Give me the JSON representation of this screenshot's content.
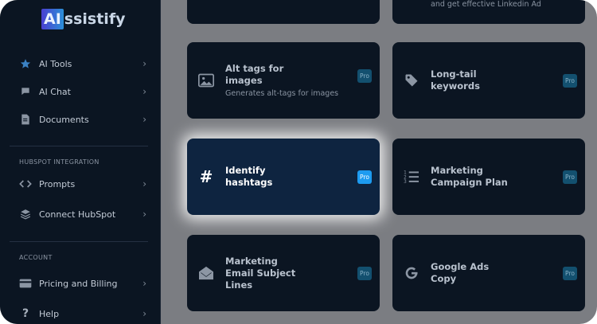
{
  "brand": {
    "logo_box": "AI",
    "logo_rest": "ssistify"
  },
  "sidebar": {
    "items": [
      {
        "label": "AI Tools",
        "icon": "star-icon"
      },
      {
        "label": "AI Chat",
        "icon": "chat-bubble-icon"
      },
      {
        "label": "Documents",
        "icon": "document-icon"
      }
    ],
    "hubspot_section": "HUBSPOT INTEGRATION",
    "hubspot_items": [
      {
        "label": "Prompts",
        "icon": "code-icon"
      },
      {
        "label": "Connect HubSpot",
        "icon": "layers-icon"
      }
    ],
    "account_section": "ACCOUNT",
    "account_items": [
      {
        "label": "Pricing and Billing",
        "icon": "credit-card-icon"
      },
      {
        "label": "Help",
        "icon": "question-icon"
      }
    ]
  },
  "tools": {
    "top_right_partial": "and get effective Linkedin Ad",
    "cards": [
      {
        "title": "Alt tags for images",
        "title_lines": [
          "Alt tags for",
          "images"
        ],
        "desc": "Generates alt-tags for images",
        "badge": "Pro",
        "icon": "image-icon"
      },
      {
        "title": "Long-tail keywords",
        "title_lines": [
          "Long-tail",
          "keywords"
        ],
        "desc": "",
        "badge": "Pro",
        "icon": "tag-icon"
      },
      {
        "title": "Identify hashtags",
        "title_lines": [
          "Identify",
          "hashtags"
        ],
        "desc": "",
        "badge": "Pro",
        "icon": "hashtag-icon"
      },
      {
        "title": "Marketing Campaign Plan",
        "title_lines": [
          "Marketing",
          "Campaign Plan"
        ],
        "desc": "",
        "badge": "Pro",
        "icon": "numbered-list-icon"
      },
      {
        "title": "Marketing Email Subject Lines",
        "title_lines": [
          "Marketing",
          "Email Subject",
          "Lines"
        ],
        "desc": "",
        "badge": "Pro",
        "icon": "envelope-icon"
      },
      {
        "title": "Google Ads Copy",
        "title_lines": [
          "Google Ads",
          "Copy"
        ],
        "desc": "",
        "badge": "Pro",
        "icon": "google-icon"
      }
    ]
  },
  "colors": {
    "accent": "#1d9bf0",
    "sidebar_bg": "#0b1522",
    "overlay": "#7b7d82"
  }
}
